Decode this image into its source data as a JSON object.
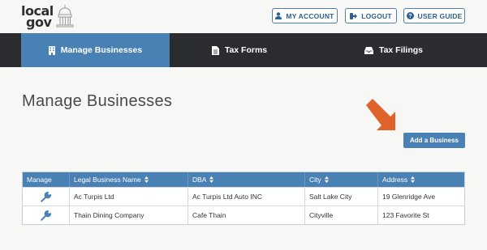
{
  "brand": {
    "logo_top": "local",
    "logo_bottom": "gov"
  },
  "header": {
    "my_account": "MY ACCOUNT",
    "logout": "LOGOUT",
    "user_guide": "USER GUIDE"
  },
  "nav": {
    "tabs": [
      {
        "label": "Manage Businesses",
        "icon": "building-icon",
        "active": true
      },
      {
        "label": "Tax Forms",
        "icon": "document-icon",
        "active": false
      },
      {
        "label": "Tax Filings",
        "icon": "inbox-icon",
        "active": false
      }
    ]
  },
  "main": {
    "title": "Manage Businesses",
    "add_button": "Add a Business"
  },
  "table": {
    "headers": [
      "Manage",
      "Legal Business Name",
      "DBA",
      "City",
      "Address"
    ],
    "rows": [
      {
        "name": "Ac Turpis Ltd",
        "dba": "Ac Turpis Ltd Auto INC",
        "city": "Salt Lake City",
        "address": "19 Glenridge Ave"
      },
      {
        "name": "Thain Dining Company",
        "dba": "Cafe Thain",
        "city": "Cityville",
        "address": "123 Favorite St"
      }
    ]
  },
  "colors": {
    "primary": "#4a81b4",
    "nav_bg": "#2b2c2f",
    "arrow": "#e0622b",
    "page_bg": "#f7f7f5"
  }
}
